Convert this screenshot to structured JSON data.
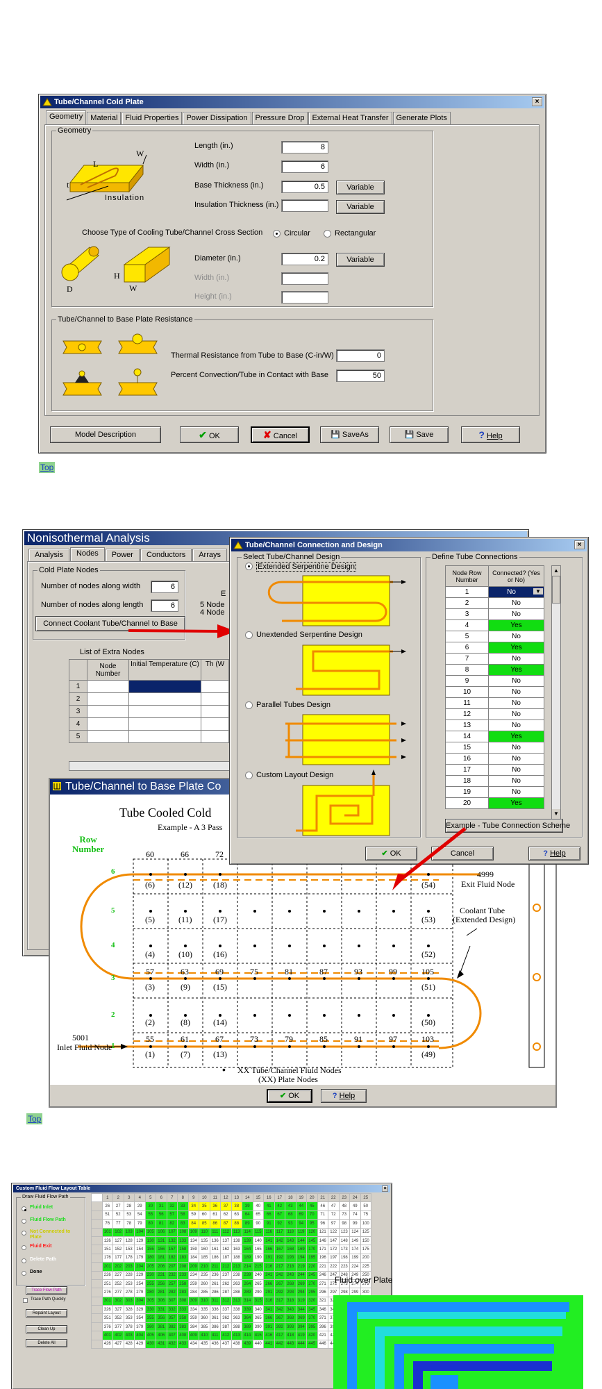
{
  "cold_plate": {
    "title": "Tube/Channel Cold Plate",
    "tabs": [
      {
        "label": "Geometry"
      },
      {
        "label": "Material"
      },
      {
        "label": "Fluid Properties"
      },
      {
        "label": "Power Dissipation"
      },
      {
        "label": "Pressure Drop"
      },
      {
        "label": "External Heat Transfer"
      },
      {
        "label": "Generate Plots"
      }
    ],
    "geometry_group": "Geometry",
    "diagram_labels": {
      "w": "W",
      "l": "L",
      "t": "t",
      "insulation": "Insulation",
      "d": "D",
      "h": "H",
      "w2": "W"
    },
    "fields": {
      "length": {
        "label": "Length (in.)",
        "value": "8"
      },
      "width": {
        "label": "Width (in.)",
        "value": "6"
      },
      "base_thickness": {
        "label": "Base Thickness (in.)",
        "value": "0.5"
      },
      "insulation_thickness": {
        "label": "Insulation Thickness (in.)",
        "value": ""
      },
      "diameter": {
        "label": "Diameter (in.)",
        "value": "0.2"
      },
      "width_dis": {
        "label": "Width (in.)",
        "value": ""
      },
      "height_dis": {
        "label": "Height (in.)",
        "value": ""
      }
    },
    "variable_label": "Variable",
    "cross_section_prompt": "Choose Type of Cooling Tube/Channel Cross Section",
    "circular": "Circular",
    "rectangular": "Rectangular",
    "resistance_group": "Tube/Channel to Base Plate Resistance",
    "thermal_resistance": {
      "label": "Thermal Resistance from Tube to Base (C-in/W)",
      "value": "0"
    },
    "percent_convection": {
      "label": "Percent Convection/Tube in Contact with Base",
      "value": "50"
    },
    "buttons": {
      "model_description": "Model Description",
      "ok": "OK",
      "cancel": "Cancel",
      "saveas": "SaveAs",
      "save": "Save",
      "help": "Help"
    }
  },
  "top_link_1": "Top",
  "nonisothermal": {
    "title": "Nonisothermal Analysis",
    "tabs": [
      {
        "label": "Analysis"
      },
      {
        "label": "Nodes"
      },
      {
        "label": "Power"
      },
      {
        "label": "Conductors"
      },
      {
        "label": "Arrays"
      }
    ],
    "cold_plate_nodes": "Cold Plate Nodes",
    "nodes_width": {
      "label": "Number of nodes along width",
      "value": "6"
    },
    "nodes_length": {
      "label": "Number of nodes along length",
      "value": "6"
    },
    "connect_button": "Connect Coolant Tube/Channel to Base",
    "side_text_1": "5 Node",
    "side_text_2": "4 Node",
    "side_text_e": "E",
    "extra_nodes": "List of Extra Nodes",
    "extra_headers": [
      "Node Number",
      "Initial Temperature (C)",
      "Th (W"
    ],
    "extra_rows": [
      "1",
      "2",
      "3",
      "4",
      "5"
    ]
  },
  "connection": {
    "title": "Tube/Channel Connection and Design",
    "select_group": "Select Tube/Channel Design",
    "designs": [
      {
        "label": "Extended Serpentine Design"
      },
      {
        "label": "Unextended Serpentine Design"
      },
      {
        "label": "Parallel Tubes Design"
      },
      {
        "label": "Custom Layout Design"
      }
    ],
    "define_group": "Define Tube Connections",
    "col_row": "Node Row Number",
    "col_conn": "Connected? (Yes or No)",
    "rows": [
      {
        "n": "1",
        "v": "No"
      },
      {
        "n": "2",
        "v": "No"
      },
      {
        "n": "3",
        "v": "No"
      },
      {
        "n": "4",
        "v": "Yes"
      },
      {
        "n": "5",
        "v": "No"
      },
      {
        "n": "6",
        "v": "Yes"
      },
      {
        "n": "7",
        "v": "No"
      },
      {
        "n": "8",
        "v": "Yes"
      },
      {
        "n": "9",
        "v": "No"
      },
      {
        "n": "10",
        "v": "No"
      },
      {
        "n": "11",
        "v": "No"
      },
      {
        "n": "12",
        "v": "No"
      },
      {
        "n": "13",
        "v": "No"
      },
      {
        "n": "14",
        "v": "Yes"
      },
      {
        "n": "15",
        "v": "No"
      },
      {
        "n": "16",
        "v": "No"
      },
      {
        "n": "17",
        "v": "No"
      },
      {
        "n": "18",
        "v": "No"
      },
      {
        "n": "19",
        "v": "No"
      },
      {
        "n": "20",
        "v": "Yes"
      }
    ],
    "example_button": "Example - Tube Connection Scheme",
    "ok": "OK",
    "cancel": "Cancel",
    "help": "Help"
  },
  "base_plate": {
    "title": "Tube/Channel to Base Plate Co",
    "heading": "Tube Cooled Cold",
    "subheading": "Example - A 3 Pass",
    "row_number": "Row Number",
    "row_labels": [
      "6",
      "5",
      "4",
      "3",
      "2",
      "1"
    ],
    "top_nums": [
      "60",
      "66",
      "72"
    ],
    "r6_nodes": [
      "(6)",
      "(12)",
      "(18)",
      "(54)"
    ],
    "r5_nodes": [
      "(5)",
      "(11)",
      "(17)",
      "(53)"
    ],
    "r4_nodes": [
      "(4)",
      "(10)",
      "(16)",
      "(52)"
    ],
    "r3_nums": [
      "57",
      "63",
      "69",
      "75",
      "81",
      "87",
      "93",
      "99",
      "105"
    ],
    "r3_nodes": [
      "(3)",
      "(9)",
      "(15)",
      "(51)"
    ],
    "r2_nodes": [
      "(2)",
      "(8)",
      "(14)",
      "(50)"
    ],
    "r1_nums": [
      "55",
      "61",
      "67",
      "73",
      "79",
      "85",
      "91",
      "97",
      "103"
    ],
    "r1_nodes": [
      "(1)",
      "(7)",
      "(13)",
      "(49)"
    ],
    "exit_num": "4999",
    "exit_label": "Exit Fluid Node",
    "coolant_1": "Coolant Tube",
    "coolant_2": "(Extended Design)",
    "inlet_num": "5001",
    "inlet_label": "Inlet Fluid Node",
    "legend_1": "XX Tube/Channel Fluid Nodes",
    "legend_2": "(XX) Plate Nodes",
    "ok": "OK",
    "help": "Help"
  },
  "top_link_2": "Top",
  "custom_layout": {
    "title": "Custom Fluid Flow Layout Table",
    "draw_group": "Draw Fluid Flow Path",
    "options": [
      {
        "label": "Fluid Inlet",
        "color": "#22dd22"
      },
      {
        "label": "Fluid Flow Path",
        "color": "#22dd22"
      },
      {
        "label": "Not Connected to Plate",
        "color": "#cccc00"
      },
      {
        "label": "Fluid Exit",
        "color": "#ff2222"
      },
      {
        "label": "Delete Path",
        "color": "#ffffff"
      },
      {
        "label": "Done",
        "color": "#000000"
      }
    ],
    "trace_button": "Trace Flow Path",
    "trace_quickly": "Trace Path Quickly",
    "repaint": "Repaint Layout",
    "clean_up": "Clean Up",
    "delete_all": "Delete All",
    "grid_header": [
      "1",
      "2",
      "3",
      "4",
      "5",
      "6",
      "7",
      "8",
      "9",
      "10",
      "11",
      "12",
      "13",
      "14",
      "15",
      "16",
      "17",
      "18",
      "19",
      "20",
      "21",
      "22",
      "23",
      "24",
      "25"
    ],
    "grid_first_col": [
      "26",
      "51",
      "76",
      "101",
      "126",
      "151",
      "176",
      "201",
      "226",
      "251",
      "276",
      "301",
      "326",
      "351",
      "376",
      "401",
      "426"
    ]
  },
  "fluid_plot": {
    "title": "Fluid over Plate",
    "colors": {
      "green": "#22ee22",
      "blue": "#1a90ff",
      "cyan": "#22dddd"
    }
  }
}
